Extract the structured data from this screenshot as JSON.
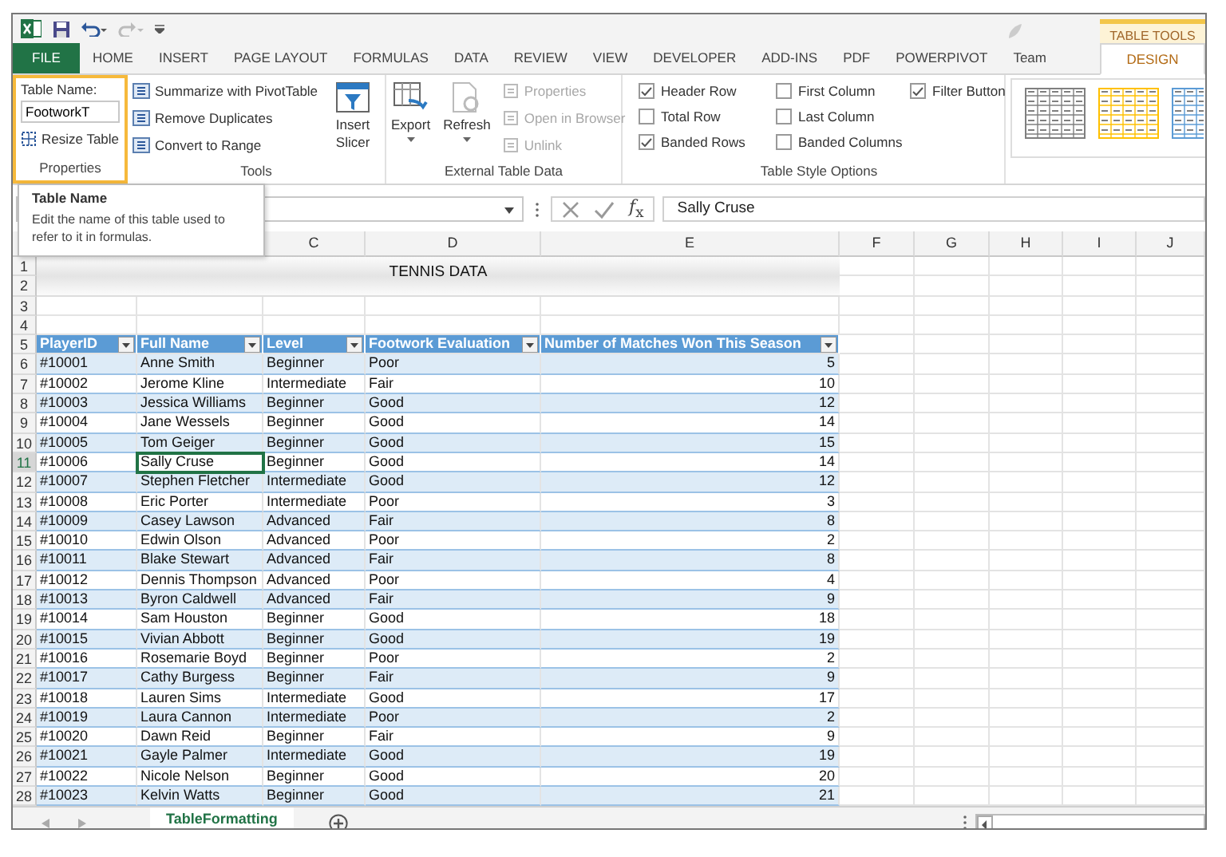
{
  "context_label": "TABLE TOOLS",
  "tabs": [
    {
      "label": "FILE",
      "kind": "file",
      "selected": false
    },
    {
      "label": "HOME",
      "kind": "plain",
      "selected": false
    },
    {
      "label": "INSERT",
      "kind": "plain",
      "selected": false
    },
    {
      "label": "PAGE LAYOUT",
      "kind": "plain",
      "selected": false
    },
    {
      "label": "FORMULAS",
      "kind": "plain",
      "selected": false
    },
    {
      "label": "DATA",
      "kind": "plain",
      "selected": false
    },
    {
      "label": "REVIEW",
      "kind": "plain",
      "selected": false
    },
    {
      "label": "VIEW",
      "kind": "plain",
      "selected": false
    },
    {
      "label": "DEVELOPER",
      "kind": "plain",
      "selected": false
    },
    {
      "label": "ADD-INS",
      "kind": "plain",
      "selected": false
    },
    {
      "label": "PDF",
      "kind": "plain",
      "selected": false
    },
    {
      "label": "POWERPIVOT",
      "kind": "plain",
      "selected": false
    },
    {
      "label": "Team",
      "kind": "team",
      "selected": false
    },
    {
      "label": "DESIGN",
      "kind": "contextual",
      "selected": true
    }
  ],
  "ribbon": {
    "properties": {
      "name_label": "Table Name:",
      "name_value": "FootworkT",
      "resize": "Resize Table",
      "group": "Properties",
      "highlighted": true
    },
    "tools": {
      "buttons": [
        "Summarize with PivotTable",
        "Remove Duplicates",
        "Convert to Range"
      ],
      "slicer": "Insert Slicer",
      "group": "Tools"
    },
    "external": {
      "big": [
        {
          "label": "Export"
        },
        {
          "label": "Refresh"
        }
      ],
      "small": [
        {
          "label": "Properties",
          "disabled": true
        },
        {
          "label": "Open in Browser",
          "disabled": true
        },
        {
          "label": "Unlink",
          "disabled": true
        }
      ],
      "group": "External Table Data"
    },
    "style_options": {
      "options": [
        {
          "label": "Header Row",
          "checked": true
        },
        {
          "label": "Total Row",
          "checked": false
        },
        {
          "label": "Banded Rows",
          "checked": true
        },
        {
          "label": "First Column",
          "checked": false
        },
        {
          "label": "Last Column",
          "checked": false
        },
        {
          "label": "Banded Columns",
          "checked": false
        },
        {
          "label": "Filter Button",
          "checked": true
        }
      ],
      "group": "Table Style Options"
    },
    "styles": [
      {
        "color": "#7f7f7f"
      },
      {
        "color": "#ffc000"
      },
      {
        "color": "#5b9bd5"
      }
    ]
  },
  "tooltip": {
    "title": "Table Name",
    "text": "Edit the name of this table used to refer to it in formulas."
  },
  "formula_bar": {
    "function_label": "*f*$_{x}$",
    "value": "Sally Cruse"
  },
  "sheet": {
    "column_headers": [
      "C",
      "D",
      "E",
      "F",
      "G",
      "H",
      "I",
      "J"
    ],
    "row_numbers": [
      "1",
      "2",
      "3",
      "4",
      "5",
      "6",
      "7",
      "8",
      "9",
      "10",
      "11",
      "12",
      "13",
      "14",
      "15",
      "16",
      "17",
      "18",
      "19",
      "20",
      "21",
      "22",
      "23",
      "24",
      "25",
      "26",
      "27",
      "28"
    ],
    "title": "TENNIS DATA",
    "table": {
      "columns": [
        "PlayerID",
        "Full Name",
        "Level",
        "Footwork Evaluation",
        "Number of Matches Won This Season"
      ],
      "rows": [
        {
          "cells": [
            "#10001",
            "Anne Smith",
            "Beginner",
            "Poor",
            "5"
          ],
          "selected": false
        },
        {
          "cells": [
            "#10002",
            "Jerome Kline",
            "Intermediate",
            "Fair",
            "10"
          ],
          "selected": false
        },
        {
          "cells": [
            "#10003",
            "Jessica Williams",
            "Beginner",
            "Good",
            "12"
          ],
          "selected": false
        },
        {
          "cells": [
            "#10004",
            "Jane Wessels",
            "Beginner",
            "Good",
            "14"
          ],
          "selected": false
        },
        {
          "cells": [
            "#10005",
            "Tom Geiger",
            "Beginner",
            "Good",
            "15"
          ],
          "selected": false
        },
        {
          "cells": [
            "#10006",
            "Sally Cruse",
            "Beginner",
            "Good",
            "14"
          ],
          "selected": true
        },
        {
          "cells": [
            "#10007",
            "Stephen Fletcher",
            "Intermediate",
            "Good",
            "12"
          ],
          "selected": false
        },
        {
          "cells": [
            "#10008",
            "Eric Porter",
            "Intermediate",
            "Poor",
            "3"
          ],
          "selected": false
        },
        {
          "cells": [
            "#10009",
            "Casey Lawson",
            "Advanced",
            "Fair",
            "8"
          ],
          "selected": false
        },
        {
          "cells": [
            "#10010",
            "Edwin Olson",
            "Advanced",
            "Poor",
            "2"
          ],
          "selected": false
        },
        {
          "cells": [
            "#10011",
            "Blake Stewart",
            "Advanced",
            "Fair",
            "8"
          ],
          "selected": false
        },
        {
          "cells": [
            "#10012",
            "Dennis Thompson",
            "Advanced",
            "Poor",
            "4"
          ],
          "selected": false
        },
        {
          "cells": [
            "#10013",
            "Byron Caldwell",
            "Advanced",
            "Fair",
            "9"
          ],
          "selected": false
        },
        {
          "cells": [
            "#10014",
            "Sam Houston",
            "Beginner",
            "Good",
            "18"
          ],
          "selected": false
        },
        {
          "cells": [
            "#10015",
            "Vivian Abbott",
            "Beginner",
            "Good",
            "19"
          ],
          "selected": false
        },
        {
          "cells": [
            "#10016",
            "Rosemarie Boyd",
            "Beginner",
            "Poor",
            "2"
          ],
          "selected": false
        },
        {
          "cells": [
            "#10017",
            "Cathy Burgess",
            "Beginner",
            "Fair",
            "9"
          ],
          "selected": false
        },
        {
          "cells": [
            "#10018",
            "Lauren Sims",
            "Intermediate",
            "Good",
            "17"
          ],
          "selected": false
        },
        {
          "cells": [
            "#10019",
            "Laura Cannon",
            "Intermediate",
            "Poor",
            "2"
          ],
          "selected": false
        },
        {
          "cells": [
            "#10020",
            "Dawn Reid",
            "Beginner",
            "Fair",
            "9"
          ],
          "selected": false
        },
        {
          "cells": [
            "#10021",
            "Gayle Palmer",
            "Intermediate",
            "Good",
            "19"
          ],
          "selected": false
        },
        {
          "cells": [
            "#10022",
            "Nicole Nelson",
            "Beginner",
            "Good",
            "20"
          ],
          "selected": false
        },
        {
          "cells": [
            "#10023",
            "Kelvin Watts",
            "Beginner",
            "Good",
            "21"
          ],
          "selected": false
        }
      ]
    }
  },
  "sheet_tabs": [
    {
      "label": "TableFormatting",
      "selected": true
    }
  ]
}
